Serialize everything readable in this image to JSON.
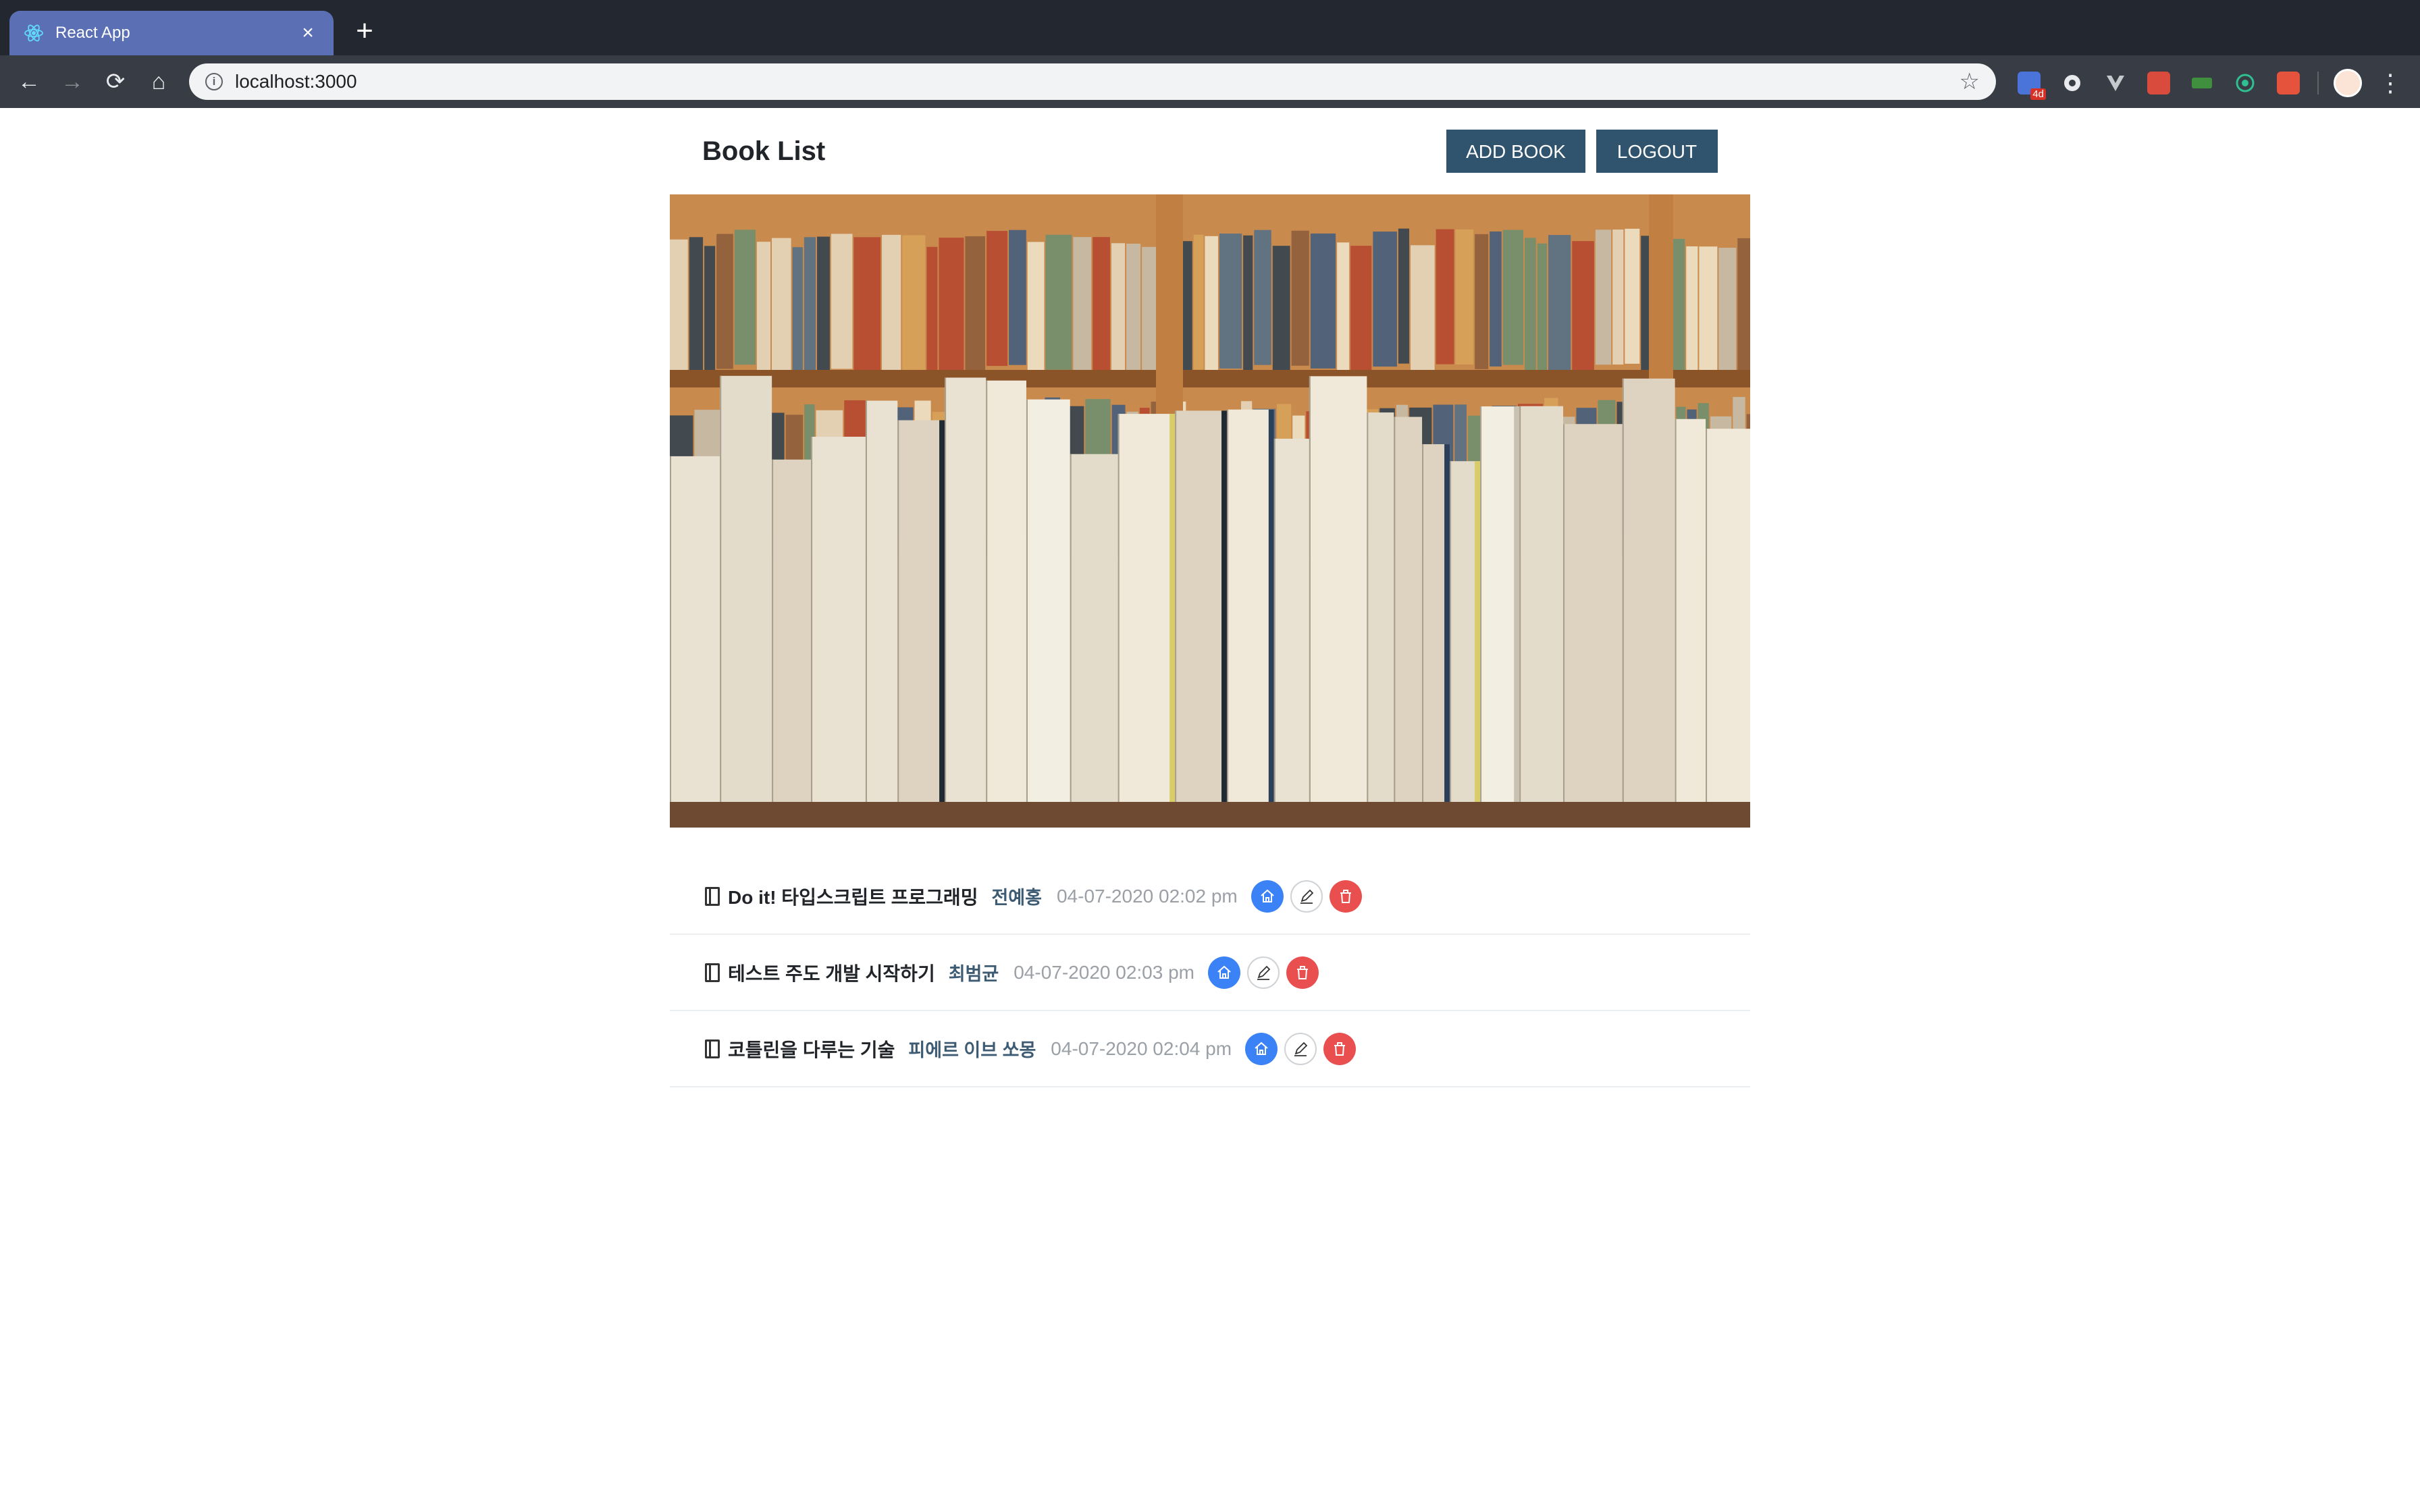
{
  "browser": {
    "tab_title": "React App",
    "tab_close": "×",
    "new_tab": "+",
    "url": "localhost:3000",
    "ext_badge": "4d",
    "nav": {
      "back": "←",
      "forward": "→",
      "reload": "⟳",
      "home": "⌂"
    },
    "star": "☆",
    "menu": "⋮"
  },
  "header": {
    "title": "Book List",
    "add_button": "ADD BOOK",
    "logout_button": "LOGOUT"
  },
  "books": [
    {
      "title": "Do it! 타입스크립트 프로그래밍",
      "author": "전예홍",
      "created": "04-07-2020 02:02 pm"
    },
    {
      "title": "테스트 주도 개발 시작하기",
      "author": "최범균",
      "created": "04-07-2020 02:03 pm"
    },
    {
      "title": "코틀린을 다루는 기술",
      "author": "피에르 이브 쏘몽",
      "created": "04-07-2020 02:04 pm"
    }
  ],
  "colors": {
    "primary_button": "#31546e",
    "home_action": "#3b82f6",
    "delete_action": "#ea4f4f",
    "author_text": "#3d5b73"
  }
}
